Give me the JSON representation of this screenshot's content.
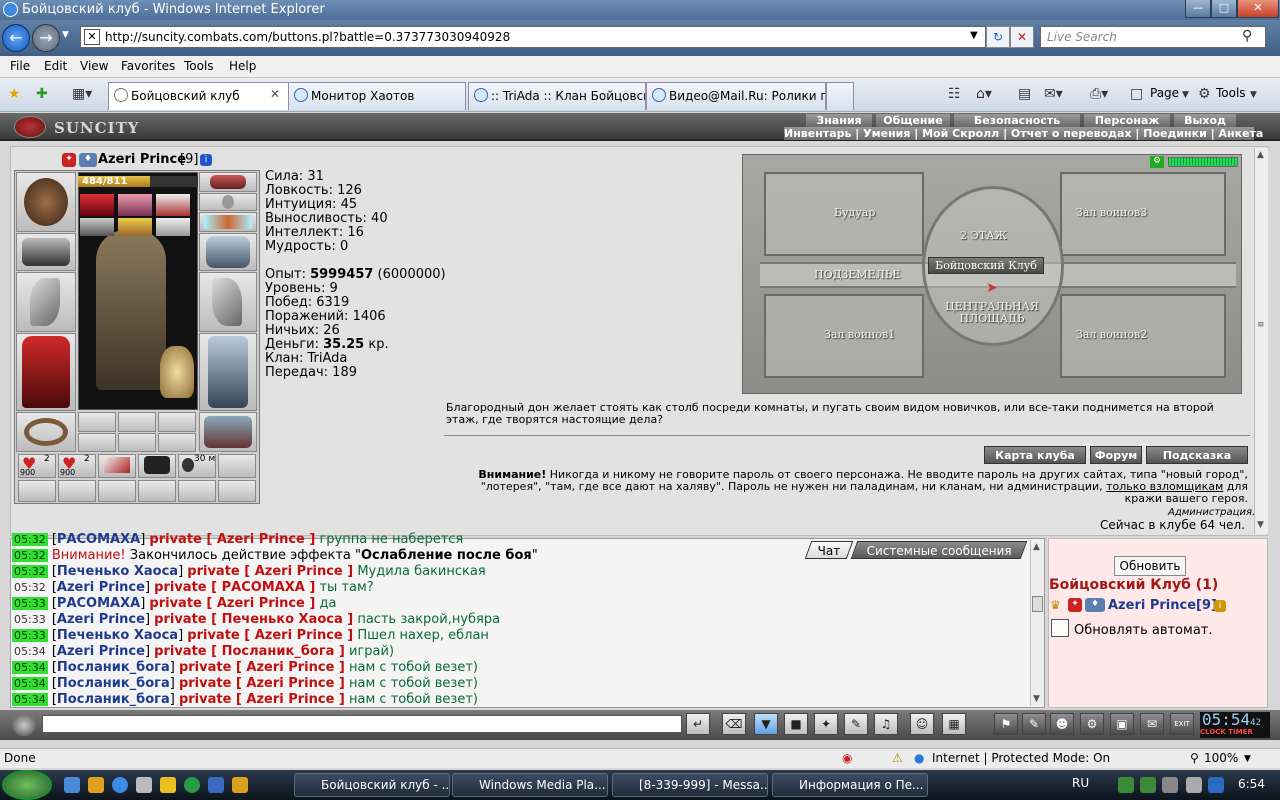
{
  "window": {
    "title": "Бойцовский клуб - Windows Internet Explorer"
  },
  "address": {
    "url": "http://suncity.combats.com/buttons.pl?battle=0.373773030940928",
    "search_placeholder": "Live Search"
  },
  "menu": [
    "File",
    "Edit",
    "View",
    "Favorites",
    "Tools",
    "Help"
  ],
  "tabs": [
    {
      "label": "Бойцовский клуб",
      "active": true
    },
    {
      "label": "Монитор Хаотов",
      "active": false
    },
    {
      "label": ":: TriAda :: Клан Бойцовск...",
      "active": false
    },
    {
      "label": "Видео@Mail.Ru: Ролики п...",
      "active": false
    }
  ],
  "toolbar": {
    "page_label": "Page",
    "tools_label": "Tools"
  },
  "game": {
    "logo": "SUNCITY",
    "nav_top": [
      "Знания",
      "Общение",
      "Безопасность",
      "Персонаж",
      "Выход"
    ],
    "nav_bottom": "Инвентарь | Умения | Мой Скролл | Отчет о переводах | Поединки | Анкета"
  },
  "character": {
    "name": "Azeri Prince",
    "level": "[9]",
    "hp_text": "484/811",
    "hp_fraction": 0.597,
    "stats": [
      "Сила: 31",
      "Ловкость: 126",
      "Интуиция: 45",
      "Выносливость: 40",
      "Интеллект: 16",
      "Мудрость: 0"
    ],
    "exp_label": "Опыт: ",
    "exp_value": "5999457",
    "exp_next": " (6000000)",
    "level_line": "Уровень: 9",
    "wins": "Побед: 6319",
    "losses": "Поражений: 1406",
    "draws": "Ничьих: 26",
    "money_label": "Деньги: ",
    "money_value": "35.25",
    "money_unit": " кр.",
    "clan": "Клан: TriAda",
    "transfers": "Передач: 189",
    "belt": [
      {
        "count": "2",
        "sub": "900"
      },
      {
        "count": "2",
        "sub": "900"
      },
      {
        "count": "",
        "sub": ""
      },
      {
        "count": "",
        "sub": ""
      },
      {
        "count": "30 м",
        "sub": ""
      },
      {
        "count": "",
        "sub": ""
      }
    ]
  },
  "map": {
    "rooms": [
      "Будуар",
      "Зал воинов3",
      "ПОДЗЕМЕЛЬЕ",
      "Зал воинов1",
      "Зал воинов2"
    ],
    "floor": "2 ЭТАЖ",
    "club": "Бойцовский Клуб",
    "square": "ЦЕНТРАЛЬНАЯ ПЛОЩАДЬ"
  },
  "description": "Благородный дон желает стоять как столб посреди комнаты, и пугать своим видом новичков, или все-таки поднимется на второй этаж, где творятся настоящие дела?",
  "buttons": {
    "map": "Карта клуба",
    "forum": "Форум",
    "hint": "Подсказка"
  },
  "warning": {
    "head": "Внимание!",
    "body": " Никогда и никому не говорите пароль от своего персонажа. Не вводите пароль на других сайтах, типа \"новый город\", \"лотерея\", \"там, где все дают на халяву\". Пароль не нужен ни паладинам, ни кланам, ни администрации, ",
    "link": "только взломщикам",
    "tail": " для кражи вашего героя.",
    "admin": "Администрация."
  },
  "online": "Сейчас в клубе 64 чел.",
  "chat": {
    "tabs": [
      "Чат",
      "Системные сообщения"
    ],
    "lines": [
      {
        "ts": "05:32",
        "hl": true,
        "nick": "РАСОМАХА",
        "target": "private [ Azeri Prince ]",
        "text": " группа не наберется"
      },
      {
        "ts": "05:32",
        "hl": true,
        "warn": "Внимание!",
        "plain": " Закончилось действие эффекта \"",
        "bold": "Ослабление после боя",
        "end": "\""
      },
      {
        "ts": "05:32",
        "hl": true,
        "nick": "Печенько Хаоса",
        "target": "private [ Azeri Prince ]",
        "text": " Мудила бакинская"
      },
      {
        "ts": "05:32",
        "hl": false,
        "nick": "Azeri Prince",
        "target": "private [ РАСОМАХА ]",
        "text": " ты там?"
      },
      {
        "ts": "05:33",
        "hl": true,
        "nick": "РАСОМАХА",
        "target": "private [ Azeri Prince ]",
        "text": " да"
      },
      {
        "ts": "05:33",
        "hl": false,
        "nick": "Azeri Prince",
        "target": "private [ Печенько Хаоса ]",
        "text": " пасть закрой,нубяра"
      },
      {
        "ts": "05:33",
        "hl": true,
        "nick": "Печенько Хаоса",
        "target": "private [ Azeri Prince ]",
        "text": " Пшел нахер, еблан"
      },
      {
        "ts": "05:34",
        "hl": false,
        "nick": "Azeri Prince",
        "target": "private [ Посланик_бога ]",
        "text": " играй)"
      },
      {
        "ts": "05:34",
        "hl": true,
        "nick": "Посланик_бога",
        "target": "private [ Azeri Prince ]",
        "text": " нам с тобой везет)"
      },
      {
        "ts": "05:34",
        "hl": true,
        "nick": "Посланик_бога",
        "target": "private [ Azeri Prince ]",
        "text": " нам с тобой везет)"
      },
      {
        "ts": "05:34",
        "hl": true,
        "nick": "Посланик_бога",
        "target": "private [ Azeri Prince ]",
        "text": " нам с тобой везет)"
      }
    ]
  },
  "side": {
    "refresh": "Обновить",
    "club_title": "Бойцовский Клуб (1)",
    "member": "Azeri Prince[9]",
    "auto_label": "Обновлять автомат."
  },
  "clock": {
    "time": "05:54",
    "sec": "42",
    "sub": "CLOCK TIMER"
  },
  "status": {
    "left": "Done",
    "zone": "Internet | Protected Mode: On",
    "zoom": "100%"
  },
  "taskbar": {
    "tasks": [
      "Бойцовский клуб - ...",
      "Windows Media Pla...",
      "[8-339-999] - Messa...",
      "Информация о Пе..."
    ],
    "lang": "RU",
    "time": "6:54"
  },
  "colors": {
    "timestamp_bg": "#33dd33",
    "nick": "#1f3b8e",
    "private": "#c21010",
    "message": "#0c6a3a"
  }
}
